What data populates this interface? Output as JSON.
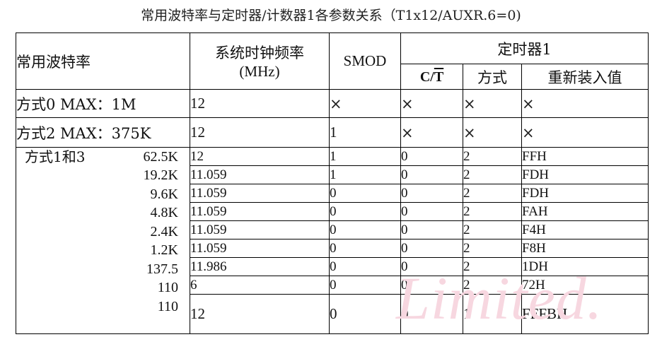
{
  "title": "常用波特率与定时器/计数器1各参数关系（T1x12/AUXR.6=0)",
  "headers": {
    "baud": "常用波特率",
    "clock_line1": "系统时钟频率",
    "clock_line2": "(MHz)",
    "smod": "SMOD",
    "timer1": "定时器1",
    "ct_c": "C/",
    "ct_t": "T",
    "mode": "方式",
    "reload": "重新装入值"
  },
  "rows_simple": [
    {
      "label": "方式0 MAX：1M",
      "clock": "12",
      "smod": "×",
      "ct": "×",
      "mode": "×",
      "reload": "×"
    },
    {
      "label": "方式2 MAX：375K",
      "clock": "12",
      "smod": "1",
      "ct": "×",
      "mode": "×",
      "reload": "×"
    }
  ],
  "mode13": {
    "label": "方式1和3",
    "rows": [
      {
        "rate": "62.5K",
        "clock": "12",
        "smod": "1",
        "ct": "0",
        "mode": "2",
        "reload": "FFH"
      },
      {
        "rate": "19.2K",
        "clock": "11.059",
        "smod": "1",
        "ct": "0",
        "mode": "2",
        "reload": "FDH"
      },
      {
        "rate": "9.6K",
        "clock": "11.059",
        "smod": "0",
        "ct": "0",
        "mode": "2",
        "reload": "FDH"
      },
      {
        "rate": "4.8K",
        "clock": "11.059",
        "smod": "0",
        "ct": "0",
        "mode": "2",
        "reload": "FAH"
      },
      {
        "rate": "2.4K",
        "clock": "11.059",
        "smod": "0",
        "ct": "0",
        "mode": "2",
        "reload": "F4H"
      },
      {
        "rate": "1.2K",
        "clock": "11.059",
        "smod": "0",
        "ct": "0",
        "mode": "2",
        "reload": "F8H"
      },
      {
        "rate": "137.5",
        "clock": "11.986",
        "smod": "0",
        "ct": "0",
        "mode": "2",
        "reload": "1DH"
      },
      {
        "rate": "110",
        "clock": "6",
        "smod": "0",
        "ct": "0",
        "mode": "2",
        "reload": "72H"
      }
    ],
    "last": {
      "rate": "110",
      "clock": "12",
      "smod": "0",
      "ct": "0",
      "mode": "1",
      "reload": "FFFBH"
    }
  },
  "watermark": "Limited."
}
